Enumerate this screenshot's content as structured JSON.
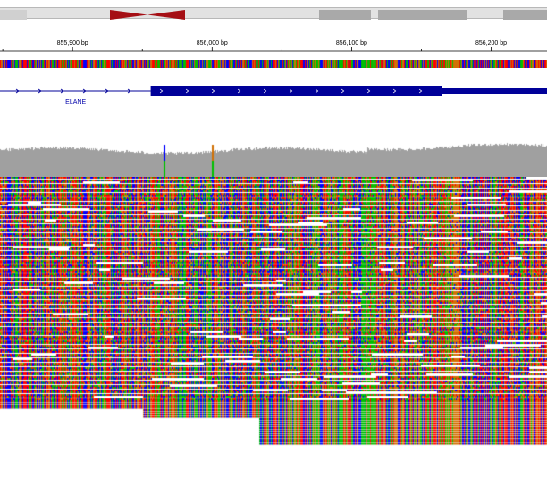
{
  "ruler": {
    "ticks": [
      {
        "label": "855,900 bp",
        "pos": 855900
      },
      {
        "label": "856,000 bp",
        "pos": 856000
      },
      {
        "label": "856,100 bp",
        "pos": 856100
      },
      {
        "label": "856,200 bp",
        "pos": 856200
      }
    ],
    "view_start": 855848,
    "view_end": 856240
  },
  "gene": {
    "name": "ELANE",
    "strand": "+",
    "intron_start": 855848,
    "exon_start": 855956,
    "exon_end": 856165,
    "utr_end": 856240
  },
  "ideogram": {
    "cytoband_colors": [
      "#e2e2e2",
      "#a9a9a9"
    ],
    "centromere_color": "#a50f15"
  },
  "coverage": {
    "color": "#a0a0a0",
    "snv_positions": [
      855965,
      856000
    ]
  },
  "bases": {
    "A": "#00c000",
    "C": "#0000ff",
    "G": "#d17105",
    "T": "#ff0000"
  },
  "reads": {
    "row_count": 100,
    "lower_row_count": 20
  }
}
